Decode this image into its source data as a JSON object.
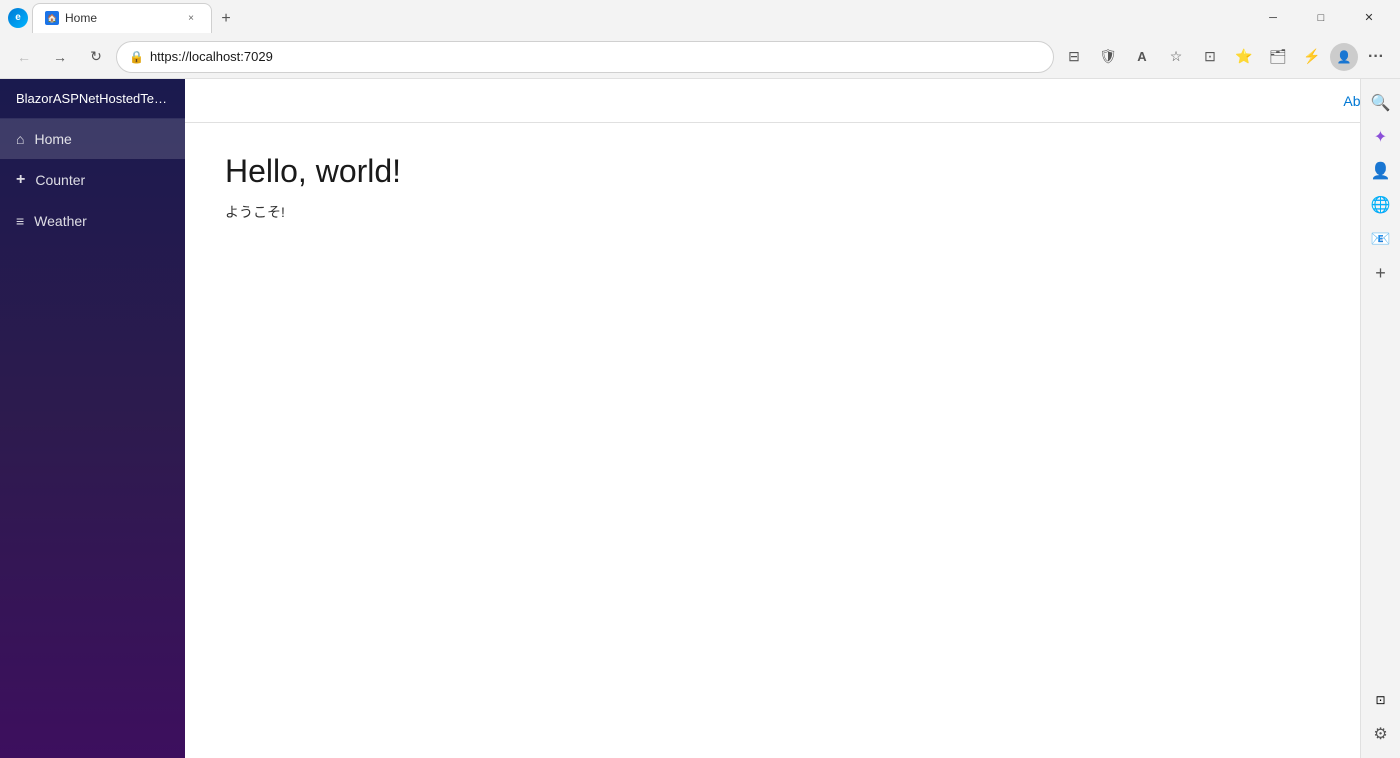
{
  "browser": {
    "tab": {
      "favicon": "🏠",
      "title": "Home",
      "close": "×"
    },
    "new_tab_label": "+",
    "address": "https://localhost:7029",
    "controls": {
      "minimize": "─",
      "maximize": "□",
      "close": "✕"
    },
    "nav": {
      "back": "←",
      "forward": "→",
      "refresh": "↻"
    },
    "toolbar_icons": {
      "split_screen": "⊟",
      "browser_essentials": "🛡",
      "reader_view": "A",
      "favorites": "☆",
      "sidebar_toggle": "⊞",
      "add_favorites": "⭐",
      "collections": "🗂",
      "extensions": "⚡",
      "profile": "👤",
      "more": "···"
    }
  },
  "right_sidebar": {
    "search": "🔍",
    "copilot": "✦",
    "collections": "📚",
    "settings": "⚙",
    "add": "+"
  },
  "app": {
    "title": "BlazorASPNetHostedTest.Cl",
    "about_label": "About",
    "nav_items": [
      {
        "id": "home",
        "icon": "⌂",
        "label": "Home",
        "active": true
      },
      {
        "id": "counter",
        "icon": "+",
        "label": "Counter",
        "active": false
      },
      {
        "id": "weather",
        "icon": "≡",
        "label": "Weather",
        "active": false
      }
    ],
    "content": {
      "heading": "Hello, world!",
      "subheading": "ようこそ!"
    }
  }
}
